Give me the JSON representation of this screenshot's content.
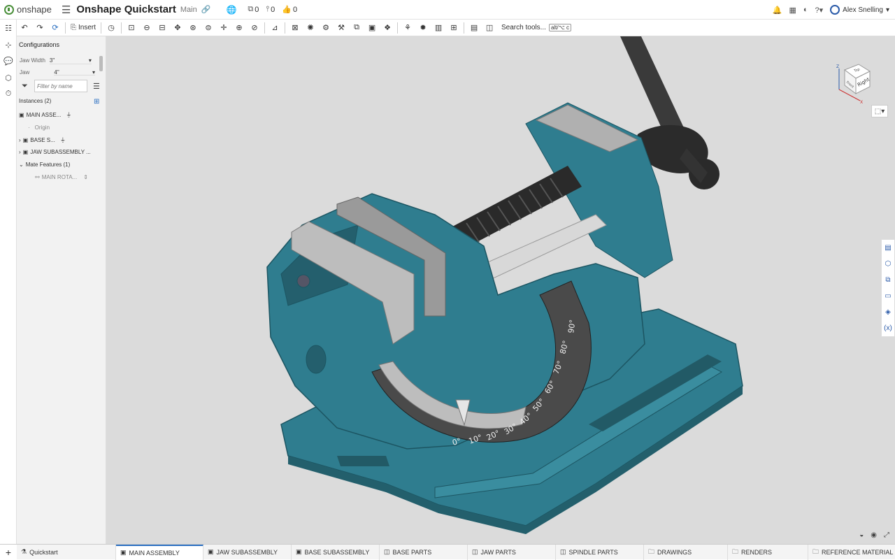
{
  "app": {
    "brand": "onshape",
    "title": "Onshape Quickstart",
    "branch": "Main"
  },
  "header": {
    "copies_count": "0",
    "versions_count": "0",
    "likes_count": "0",
    "user_name": "Alex Snelling"
  },
  "toolbar": {
    "insert_label": "Insert",
    "search_label": "Search tools...",
    "search_shortcut": "alt/⌥ c"
  },
  "panel": {
    "configurations_title": "Configurations",
    "config_rows": [
      {
        "label": "Jaw Width",
        "value": "3\""
      },
      {
        "label": "Jaw Openi...",
        "value": "4\""
      }
    ],
    "filter_placeholder": "Filter by name",
    "instances_label": "Instances (2)",
    "tree": [
      {
        "label": "MAIN ASSE..."
      },
      {
        "label": "Origin"
      },
      {
        "label": "BASE S..."
      },
      {
        "label": "JAW SUBASSEMBLY ..."
      },
      {
        "label": "Mate Features (1)"
      },
      {
        "label": "MAIN ROTA..."
      }
    ]
  },
  "viewcube": {
    "face_label": "Right",
    "top_label": "Top",
    "front_label": "Front",
    "axis_x": "X",
    "axis_z": "Z"
  },
  "scale_labels": [
    "0°",
    "10°",
    "20°",
    "30°",
    "40°",
    "50°",
    "60°",
    "70°",
    "80°",
    "90°"
  ],
  "tabs": [
    {
      "label": "Quickstart"
    },
    {
      "label": "MAIN ASSEMBLY",
      "active": true
    },
    {
      "label": "JAW SUBASSEMBLY"
    },
    {
      "label": "BASE SUBASSEMBLY"
    },
    {
      "label": "BASE PARTS"
    },
    {
      "label": "JAW PARTS"
    },
    {
      "label": "SPINDLE PARTS"
    },
    {
      "label": "DRAWINGS"
    },
    {
      "label": "RENDERS"
    },
    {
      "label": "REFERENCE MATERIAL"
    }
  ],
  "colors": {
    "accent": "#2a6fc1",
    "model_teal": "#2f7d8f",
    "viewport_bg": "#dbdbdb",
    "steel": "#a8a8a8"
  }
}
